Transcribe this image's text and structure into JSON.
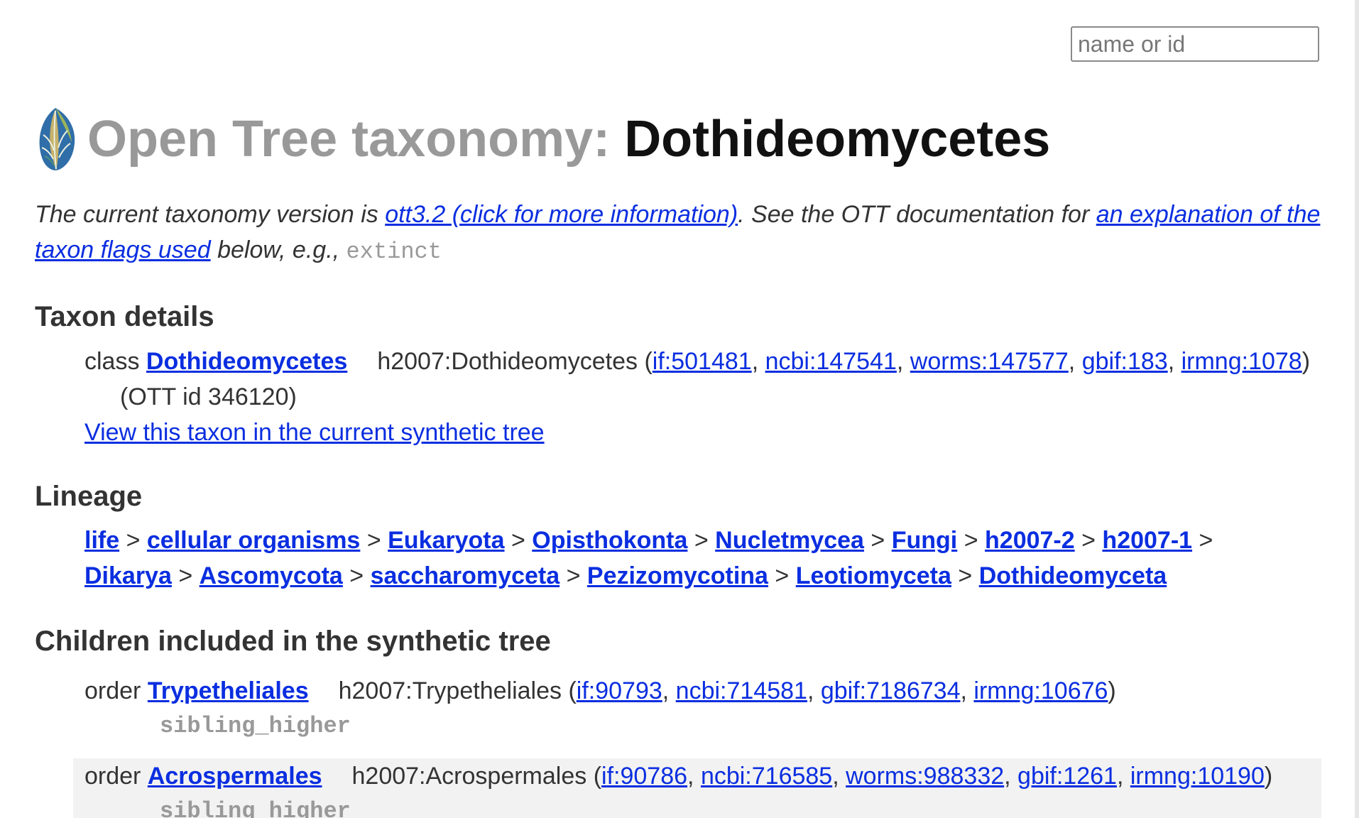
{
  "search": {
    "placeholder": "name or id"
  },
  "header": {
    "title_prefix": "Open Tree taxonomy: ",
    "title_name": "Dothideomycetes"
  },
  "intro": {
    "text1": "The current taxonomy version is ",
    "version_link": "ott3.2 (click for more information)",
    "text2": ". See the OTT documentation for ",
    "flags_link": "an explanation of the taxon flags used",
    "text3": " below, e.g., ",
    "flag_example": "extinct"
  },
  "details": {
    "heading": "Taxon details",
    "rank": "class",
    "name": "Dothideomycetes",
    "source_prefix": "h2007:Dothideomycetes (",
    "sources": [
      "if:501481",
      "ncbi:147541",
      "worms:147577",
      "gbif:183",
      "irmng:1078"
    ],
    "ott_id": "(OTT id 346120)",
    "synth_link": "View this taxon in the current synthetic tree"
  },
  "lineage": {
    "heading": "Lineage",
    "items": [
      "life",
      "cellular organisms",
      "Eukaryota",
      "Opisthokonta",
      "Nucletmycea",
      "Fungi",
      "h2007-2",
      "h2007-1",
      "Dikarya",
      "Ascomycota",
      "saccharomyceta",
      "Pezizomycotina",
      "Leotiomyceta",
      "Dothideomyceta"
    ],
    "separator": ">"
  },
  "children": {
    "heading": "Children included in the synthetic tree",
    "rows": [
      {
        "rank": "order",
        "name": "Trypetheliales",
        "source_prefix": "h2007:Trypetheliales (",
        "sources": [
          "if:90793",
          "ncbi:714581",
          "gbif:7186734",
          "irmng:10676"
        ],
        "flag": "sibling_higher"
      },
      {
        "rank": "order",
        "name": "Acrospermales",
        "source_prefix": "h2007:Acrospermales (",
        "sources": [
          "if:90786",
          "ncbi:716585",
          "worms:988332",
          "gbif:1261",
          "irmng:10190"
        ],
        "flag": "sibling_higher"
      }
    ]
  },
  "colors": {
    "link": "#0a2ee0",
    "muted": "#999999",
    "text": "#333333",
    "alt_row": "#f2f2f2"
  }
}
